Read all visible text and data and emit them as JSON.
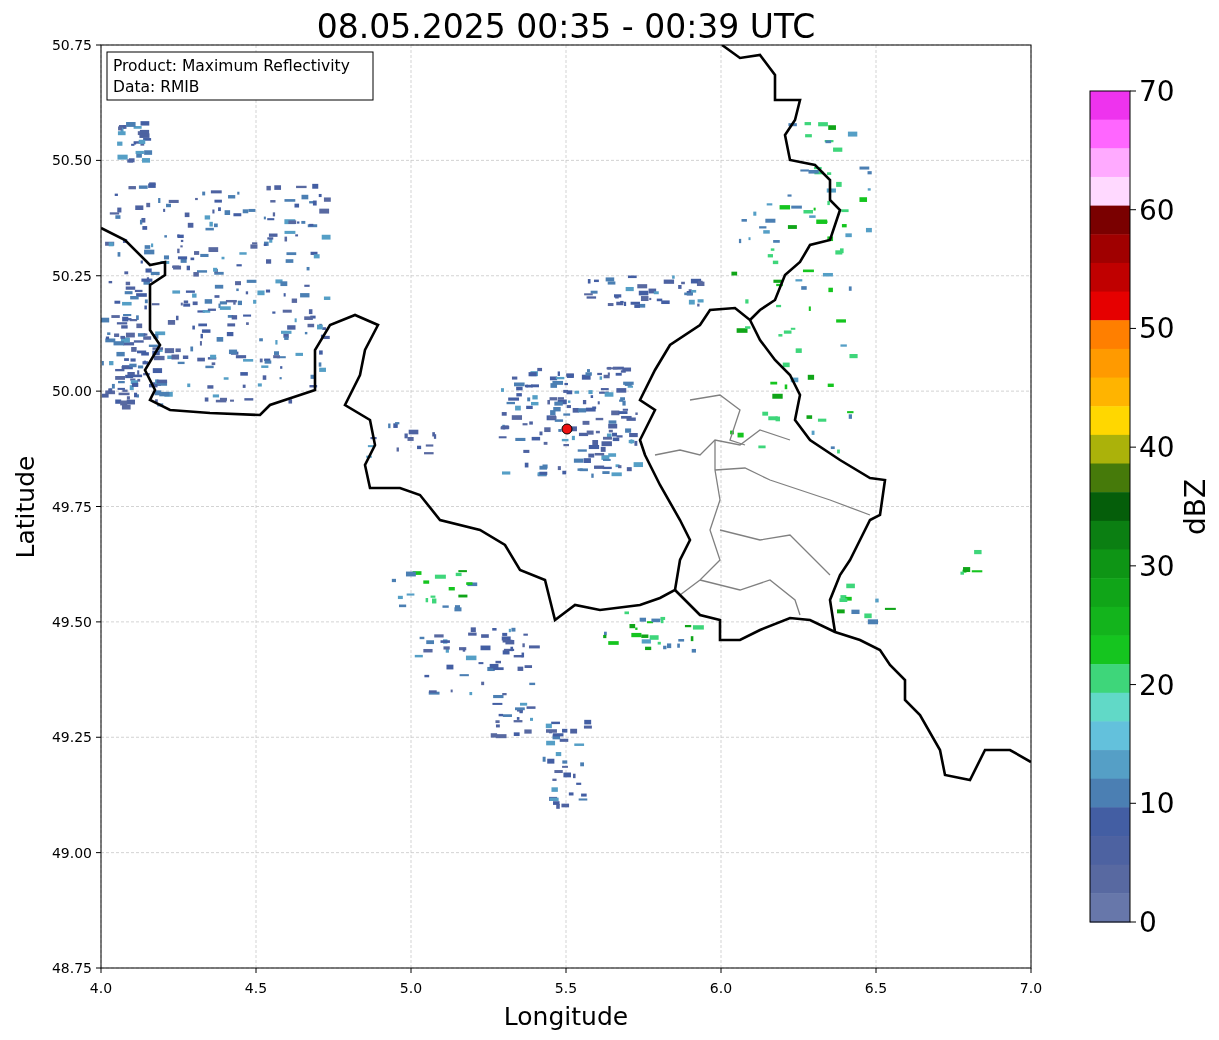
{
  "title": "08.05.2025 00:35 - 00:39 UTC",
  "legend": {
    "lines": [
      "Product: Maximum Reflectivity",
      "Data: RMIB"
    ]
  },
  "axes": {
    "xlabel": "Longitude",
    "ylabel": "Latitude",
    "xticks": [
      "4.0",
      "4.5",
      "5.0",
      "5.5",
      "6.0",
      "6.5",
      "7.0"
    ],
    "yticks": [
      "50.75",
      "50.50",
      "50.25",
      "50.00",
      "49.75",
      "49.50",
      "49.25",
      "49.00",
      "48.75"
    ]
  },
  "colorbar": {
    "label": "dBZ",
    "ticks": [
      "70",
      "60",
      "50",
      "40",
      "30",
      "20",
      "10",
      "0"
    ],
    "bins": [
      {
        "color": "#ee33ee"
      },
      {
        "color": "#ff66ff"
      },
      {
        "color": "#ffaaff"
      },
      {
        "color": "#ffd9ff"
      },
      {
        "color": "#7a0000"
      },
      {
        "color": "#a00000"
      },
      {
        "color": "#c00000"
      },
      {
        "color": "#e60000"
      },
      {
        "color": "#ff7f00"
      },
      {
        "color": "#ff9a00"
      },
      {
        "color": "#ffb400"
      },
      {
        "color": "#ffd700"
      },
      {
        "color": "#abb20a"
      },
      {
        "color": "#467a0a"
      },
      {
        "color": "#055e0a"
      },
      {
        "color": "#0b7f12"
      },
      {
        "color": "#0e9515"
      },
      {
        "color": "#10a518"
      },
      {
        "color": "#13b41c"
      },
      {
        "color": "#15c51f"
      },
      {
        "color": "#3ed67a"
      },
      {
        "color": "#61d9c7"
      },
      {
        "color": "#63c1dc"
      },
      {
        "color": "#559fc6"
      },
      {
        "color": "#4b7fb3"
      },
      {
        "color": "#435ea3"
      },
      {
        "color": "#4d62a1"
      },
      {
        "color": "#5869a1"
      },
      {
        "color": "#6777aa"
      }
    ]
  }
}
